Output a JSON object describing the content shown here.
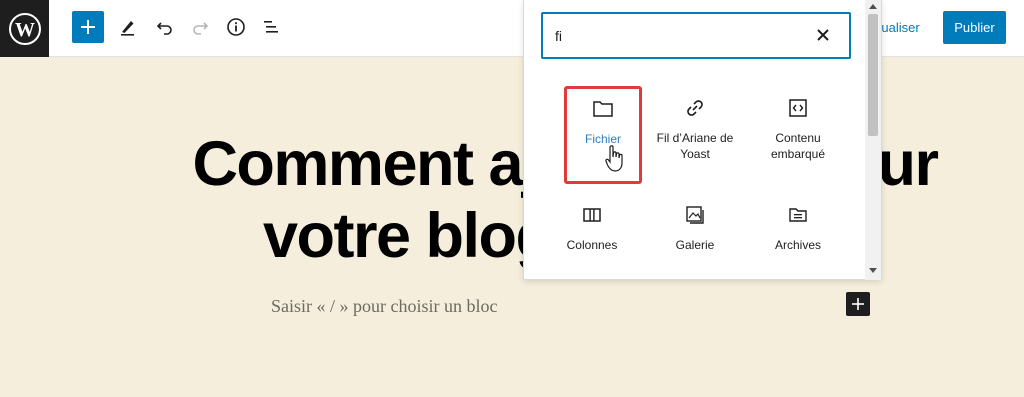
{
  "toolbar": {
    "logo_icon": "wordpress-logo",
    "tools": [
      "add-block-icon",
      "pencil-icon",
      "undo-icon",
      "redo-icon",
      "info-icon",
      "list-view-icon"
    ],
    "preview_label": "isualiser",
    "publish_label": "Publier"
  },
  "editor": {
    "title_line1": "Comment ajo",
    "title_line1_end": "r sur",
    "title_line2": "votre blog",
    "placeholder": "Saisir « / » pour choisir un bloc"
  },
  "inserter": {
    "search_value": "fi",
    "blocks": [
      {
        "label": "Fichier",
        "icon": "folder-icon",
        "selected": true
      },
      {
        "label": "Fil d’Ariane de Yoast",
        "icon": "link-icon",
        "selected": false
      },
      {
        "label": "Contenu embarqué",
        "icon": "embed-icon",
        "selected": false
      },
      {
        "label": "Colonnes",
        "icon": "columns-icon",
        "selected": false
      },
      {
        "label": "Galerie",
        "icon": "gallery-icon",
        "selected": false
      },
      {
        "label": "Archives",
        "icon": "archive-icon",
        "selected": false
      }
    ]
  },
  "colors": {
    "accent": "#007cba",
    "background": "#f5eedc",
    "highlight": "#e03b3b"
  }
}
